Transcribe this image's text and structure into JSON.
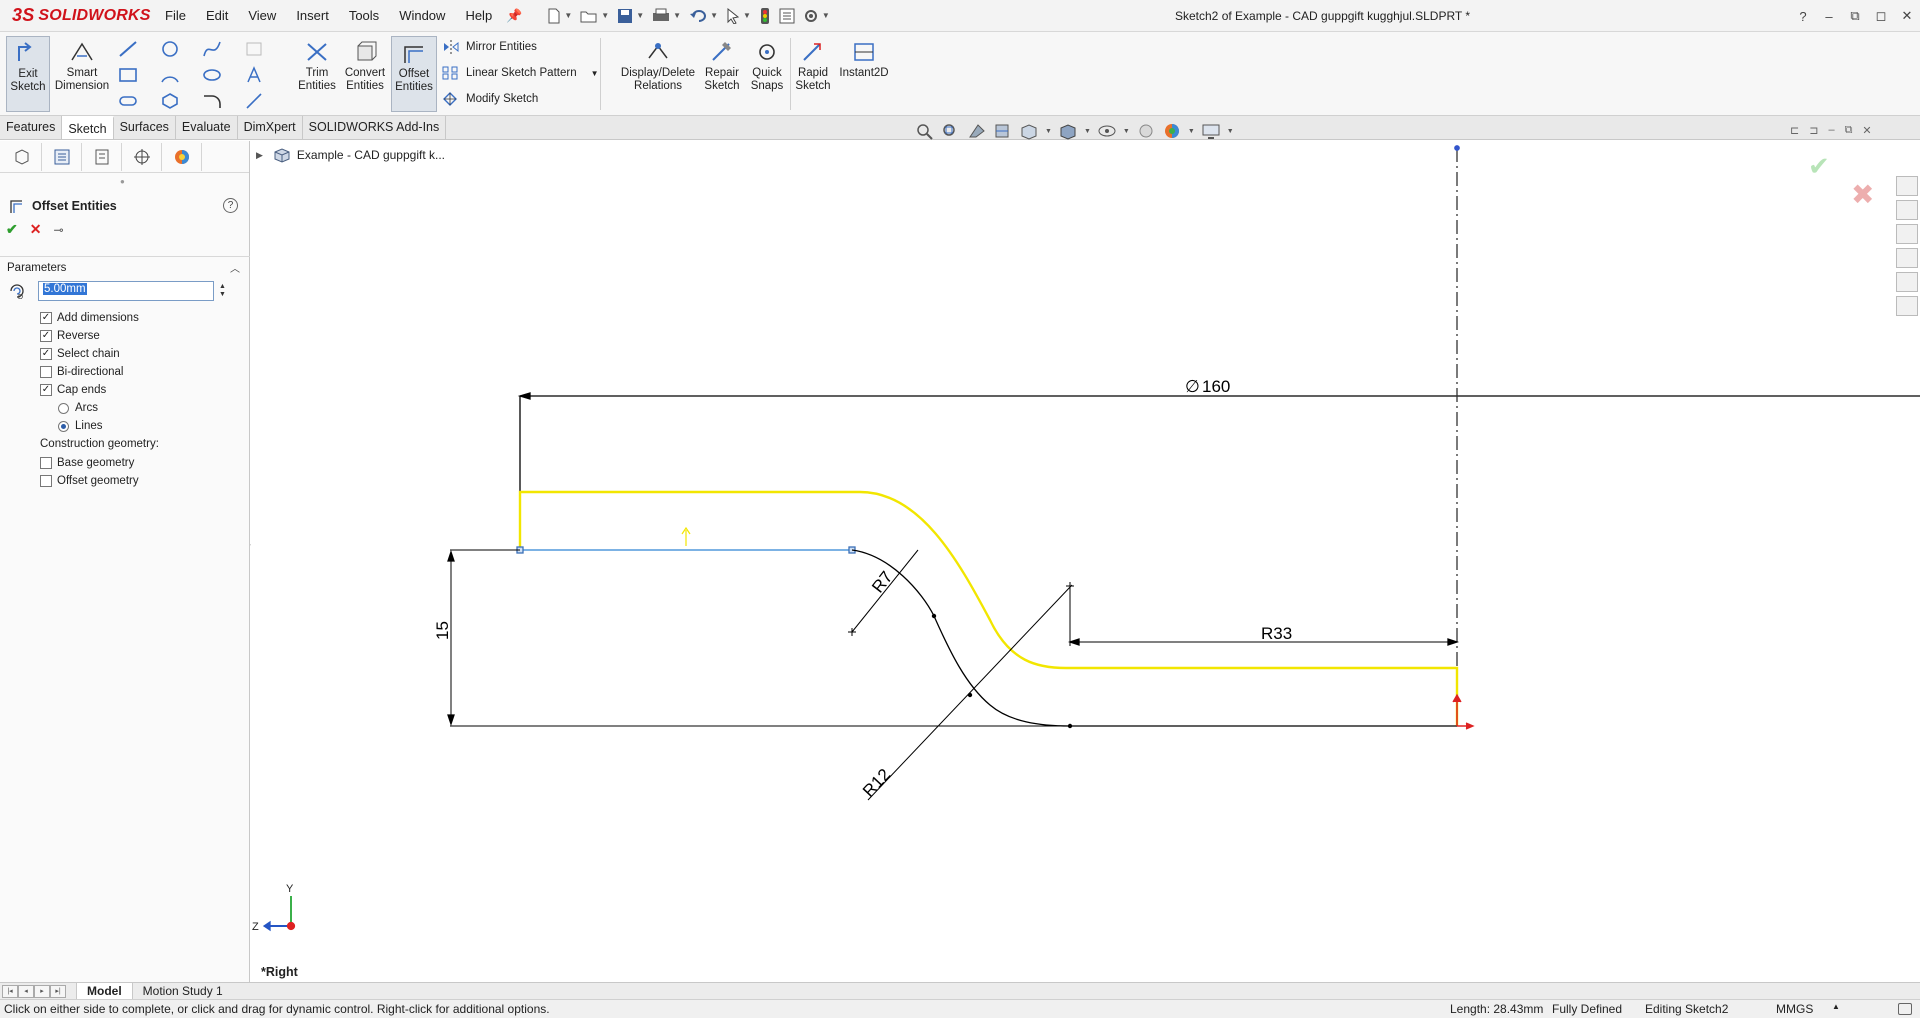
{
  "app": {
    "logo_text": "SOLIDWORKS",
    "logo_prefix": "3S",
    "doc_title": "Sketch2 of Example - CAD guppgift kugghjul.SLDPRT *"
  },
  "menu": [
    "File",
    "Edit",
    "View",
    "Insert",
    "Tools",
    "Window",
    "Help"
  ],
  "window_controls": [
    "?",
    "–",
    "⧉",
    "◻",
    "✕"
  ],
  "commands": {
    "exit_sketch": "Exit Sketch",
    "smart_dimension": "Smart Dimension",
    "trim_entities": "Trim Entities",
    "convert_entities": "Convert Entities",
    "offset_entities": "Offset Entities",
    "mirror_entities": "Mirror Entities",
    "linear_sketch_pattern": "Linear Sketch Pattern",
    "modify_sketch": "Modify Sketch",
    "display_delete_relations": "Display/Delete Relations",
    "repair_sketch": "Repair Sketch",
    "quick_snaps": "Quick Snaps",
    "rapid_sketch": "Rapid Sketch",
    "instant2d": "Instant2D"
  },
  "tabs": [
    "Features",
    "Sketch",
    "Surfaces",
    "Evaluate",
    "DimXpert",
    "SOLIDWORKS Add-Ins"
  ],
  "active_tab": "Sketch",
  "property_manager": {
    "title": "Offset Entities",
    "group_parameters": "Parameters",
    "distance_value": "5.00mm",
    "options": [
      {
        "label": "Add dimensions",
        "checked": true
      },
      {
        "label": "Reverse",
        "checked": true
      },
      {
        "label": "Select chain",
        "checked": true
      },
      {
        "label": "Bi-directional",
        "checked": false
      },
      {
        "label": "Cap ends",
        "checked": true
      }
    ],
    "cap_type": {
      "arcs": "Arcs",
      "lines": "Lines",
      "selected": "Lines"
    },
    "construction_label": "Construction geometry:",
    "construction": [
      {
        "label": "Base geometry",
        "checked": false
      },
      {
        "label": "Offset geometry",
        "checked": false
      }
    ]
  },
  "tree": {
    "root_label": "Example - CAD guppgift k..."
  },
  "sketch": {
    "dim_diameter": "160",
    "dim_height": "15",
    "dim_r7": "R7",
    "dim_r12": "R12",
    "dim_r33": "R33",
    "axis_y": "Y",
    "axis_z": "Z",
    "colors": {
      "sketch_line": "#000000",
      "offset_preview": "#f2e600",
      "selected": "#6aa7e0",
      "centerline": "#333333"
    }
  },
  "view_name": "*Right",
  "bottom_tabs": [
    "Model",
    "Motion Study 1"
  ],
  "status": {
    "message": "Click on either side to complete, or click and drag for dynamic control.  Right-click for additional options.",
    "length": "Length: 28.43mm",
    "definition": "Fully Defined",
    "editing": "Editing Sketch2",
    "units": "MMGS"
  }
}
